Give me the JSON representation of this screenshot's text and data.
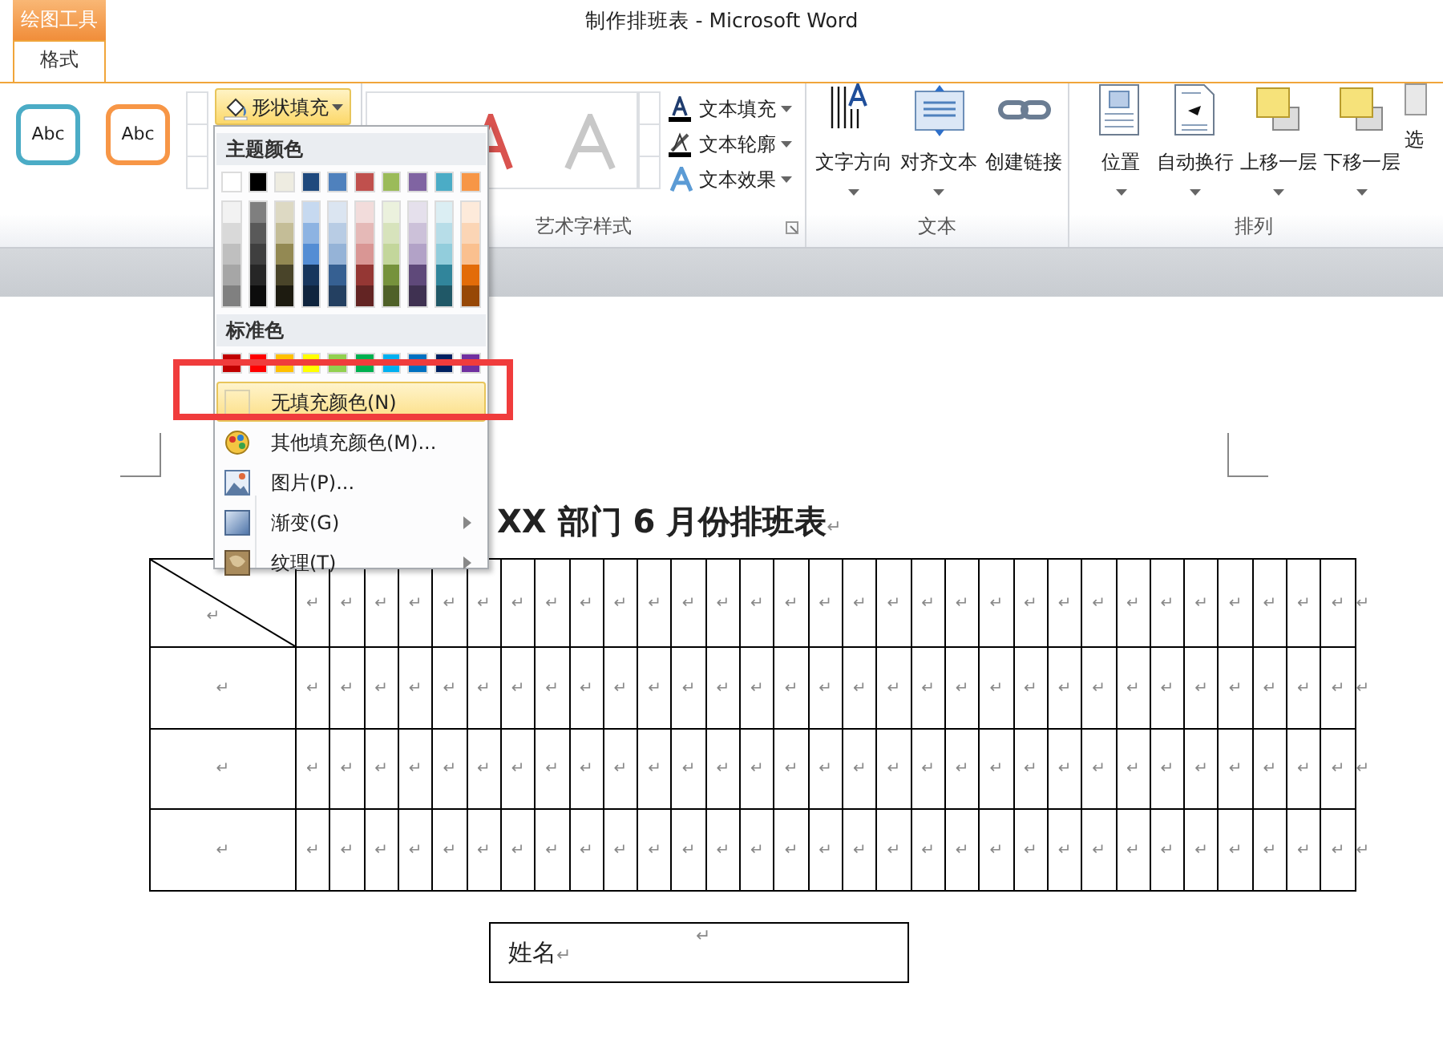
{
  "title_bar": {
    "context_tab": "绘图工具",
    "title": "制作排班表  -  Microsoft Word"
  },
  "ribbon_tabs": [
    {
      "label": "格式",
      "selected": true
    }
  ],
  "shape_styles": [
    {
      "label": "Abc",
      "color": "#4bacc6"
    },
    {
      "label": "Abc",
      "color": "#f79646"
    }
  ],
  "shape_fill": {
    "label": "形状填充",
    "pressed": true
  },
  "wordart_commands": [
    "文本填充",
    "文本轮廓",
    "文本效果"
  ],
  "groups": [
    {
      "label": "艺术字样式",
      "launcher": true
    },
    {
      "label": "文本",
      "buttons": [
        {
          "label": "文字方向",
          "dropdown": true
        },
        {
          "label": "对齐文本",
          "dropdown": true
        },
        {
          "label": "创建链接",
          "dropdown": false
        }
      ]
    },
    {
      "label": "排列",
      "buttons": [
        {
          "label": "位置",
          "dropdown": true
        },
        {
          "label": "自动换行",
          "dropdown": true
        },
        {
          "label": "上移一层",
          "dropdown": true
        },
        {
          "label": "下移一层",
          "dropdown": true
        },
        {
          "label": "选",
          "dropdown": false
        }
      ]
    }
  ],
  "fill_menu": {
    "theme_header": "主题颜色",
    "theme_colors": [
      {
        "color": "#ffffff",
        "shades": [
          {
            "color": "#f2f2f2"
          },
          {
            "color": "#d9d9d9"
          },
          {
            "color": "#bfbfbf"
          },
          {
            "color": "#a6a6a6"
          },
          {
            "color": "#808080"
          }
        ]
      },
      {
        "color": "#000000",
        "shades": [
          {
            "color": "#7f7f7f"
          },
          {
            "color": "#595959"
          },
          {
            "color": "#3f3f3f"
          },
          {
            "color": "#262626"
          },
          {
            "color": "#0c0c0c"
          }
        ]
      },
      {
        "color": "#eeece1",
        "shades": [
          {
            "color": "#ddd9c3"
          },
          {
            "color": "#c4bd97"
          },
          {
            "color": "#938953"
          },
          {
            "color": "#494429"
          },
          {
            "color": "#1d1b10"
          }
        ]
      },
      {
        "color": "#1f497d",
        "shades": [
          {
            "color": "#c6d9f0"
          },
          {
            "color": "#8db3e2"
          },
          {
            "color": "#548dd4"
          },
          {
            "color": "#17365d"
          },
          {
            "color": "#0f243e"
          }
        ]
      },
      {
        "color": "#4f81bd",
        "shades": [
          {
            "color": "#dbe5f1"
          },
          {
            "color": "#b8cce4"
          },
          {
            "color": "#95b3d7"
          },
          {
            "color": "#366092"
          },
          {
            "color": "#244061"
          }
        ]
      },
      {
        "color": "#c0504d",
        "shades": [
          {
            "color": "#f2dcdb"
          },
          {
            "color": "#e5b9b7"
          },
          {
            "color": "#d99694"
          },
          {
            "color": "#953734"
          },
          {
            "color": "#632423"
          }
        ]
      },
      {
        "color": "#9bbb59",
        "shades": [
          {
            "color": "#ebf1dd"
          },
          {
            "color": "#d7e3bc"
          },
          {
            "color": "#c3d69b"
          },
          {
            "color": "#76923c"
          },
          {
            "color": "#4f6128"
          }
        ]
      },
      {
        "color": "#8064a2",
        "shades": [
          {
            "color": "#e5e0ec"
          },
          {
            "color": "#ccc1d9"
          },
          {
            "color": "#b2a2c7"
          },
          {
            "color": "#5f497a"
          },
          {
            "color": "#3f3151"
          }
        ]
      },
      {
        "color": "#4bacc6",
        "shades": [
          {
            "color": "#dbeef3"
          },
          {
            "color": "#b7dde8"
          },
          {
            "color": "#92cddc"
          },
          {
            "color": "#31859b"
          },
          {
            "color": "#205867"
          }
        ]
      },
      {
        "color": "#f79646",
        "shades": [
          {
            "color": "#fdeada"
          },
          {
            "color": "#fbd5b5"
          },
          {
            "color": "#fac08f"
          },
          {
            "color": "#e36c09"
          },
          {
            "color": "#974806"
          }
        ]
      }
    ],
    "standard_header": "标准色",
    "standard_colors": [
      {
        "color": "#c00000"
      },
      {
        "color": "#ff0000"
      },
      {
        "color": "#ffc000"
      },
      {
        "color": "#ffff00"
      },
      {
        "color": "#92d050"
      },
      {
        "color": "#00b050"
      },
      {
        "color": "#00b0f0"
      },
      {
        "color": "#0070c0"
      },
      {
        "color": "#002060"
      },
      {
        "color": "#7030a0"
      }
    ],
    "items": [
      {
        "label": "无填充颜色(N)",
        "highlighted": true,
        "submenu": false,
        "annotated": true
      },
      {
        "label": "其他填充颜色(M)...",
        "highlighted": false,
        "submenu": false,
        "annotated": false
      },
      {
        "label": "图片(P)...",
        "highlighted": false,
        "submenu": false,
        "annotated": false
      },
      {
        "label": "渐变(G)",
        "highlighted": false,
        "submenu": true,
        "annotated": false
      },
      {
        "label": "纹理(T)",
        "highlighted": false,
        "submenu": true,
        "annotated": false
      }
    ]
  },
  "document": {
    "title": "XX 部门 6 月份排班表",
    "title_mark": "↵",
    "table_rows": [
      {
        "cells": [
          "↵",
          "↵",
          "↵",
          "↵",
          "↵",
          "↵",
          "↵",
          "↵",
          "↵",
          "↵",
          "↵",
          "↵",
          "↵",
          "↵",
          "↵",
          "↵",
          "↵",
          "↵",
          "↵",
          "↵",
          "↵",
          "↵",
          "↵",
          "↵",
          "↵",
          "↵",
          "↵",
          "↵",
          "↵",
          "↵",
          "↵",
          "↵"
        ],
        "end_mark": "↵",
        "diagonal": true
      },
      {
        "cells": [
          "↵",
          "↵",
          "↵",
          "↵",
          "↵",
          "↵",
          "↵",
          "↵",
          "↵",
          "↵",
          "↵",
          "↵",
          "↵",
          "↵",
          "↵",
          "↵",
          "↵",
          "↵",
          "↵",
          "↵",
          "↵",
          "↵",
          "↵",
          "↵",
          "↵",
          "↵",
          "↵",
          "↵",
          "↵",
          "↵",
          "↵",
          "↵"
        ],
        "end_mark": "↵",
        "diagonal": false
      },
      {
        "cells": [
          "↵",
          "↵",
          "↵",
          "↵",
          "↵",
          "↵",
          "↵",
          "↵",
          "↵",
          "↵",
          "↵",
          "↵",
          "↵",
          "↵",
          "↵",
          "↵",
          "↵",
          "↵",
          "↵",
          "↵",
          "↵",
          "↵",
          "↵",
          "↵",
          "↵",
          "↵",
          "↵",
          "↵",
          "↵",
          "↵",
          "↵",
          "↵"
        ],
        "end_mark": "↵",
        "diagonal": false
      },
      {
        "cells": [
          "↵",
          "↵",
          "↵",
          "↵",
          "↵",
          "↵",
          "↵",
          "↵",
          "↵",
          "↵",
          "↵",
          "↵",
          "↵",
          "↵",
          "↵",
          "↵",
          "↵",
          "↵",
          "↵",
          "↵",
          "↵",
          "↵",
          "↵",
          "↵",
          "↵",
          "↵",
          "↵",
          "↵",
          "↵",
          "↵",
          "↵",
          "↵"
        ],
        "end_mark": "↵",
        "diagonal": false
      }
    ],
    "name_box": {
      "label": "姓名",
      "label_mark": "↵",
      "mark": "↵"
    }
  }
}
